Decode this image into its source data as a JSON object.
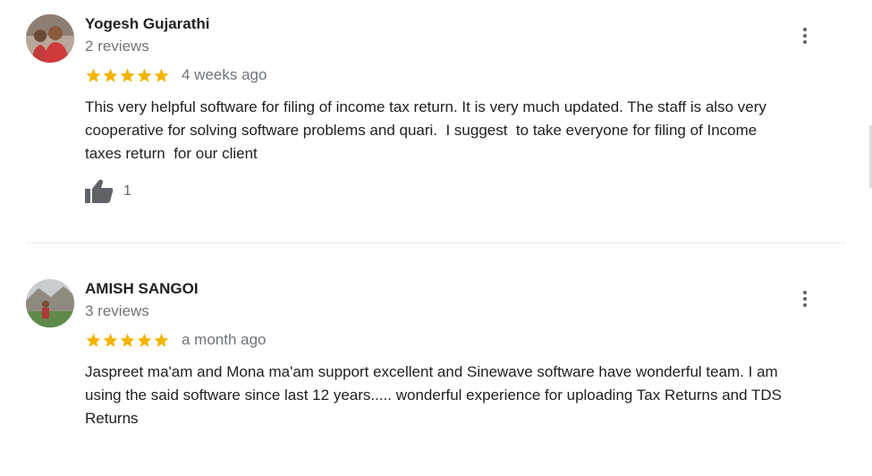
{
  "reviews": [
    {
      "author": "Yogesh Gujarathi",
      "review_count": "2 reviews",
      "rating": 5,
      "date": "4 weeks ago",
      "text": "This very helpful software for filing of income tax return. It is very much updated. The staff is also very\ncooperative for solving software problems and quari.  I suggest  to take everyone for filing of Income\ntaxes return  for our client",
      "likes": "1"
    },
    {
      "author": "AMISH SANGOI",
      "review_count": "3 reviews",
      "rating": 5,
      "date": "a month ago",
      "text": "Jaspreet ma'am and Mona ma'am support excellent and Sinewave software have wonderful team. I am\nusing the said software since last 12 years..... wonderful experience for uploading Tax Returns and TDS\nReturns"
    }
  ],
  "colors": {
    "star": "#f4b400",
    "secondary_text": "#70757a",
    "divider": "#e8eaed"
  },
  "icons": [
    "more-vert-icon",
    "star-icon",
    "thumbs-up-icon"
  ]
}
